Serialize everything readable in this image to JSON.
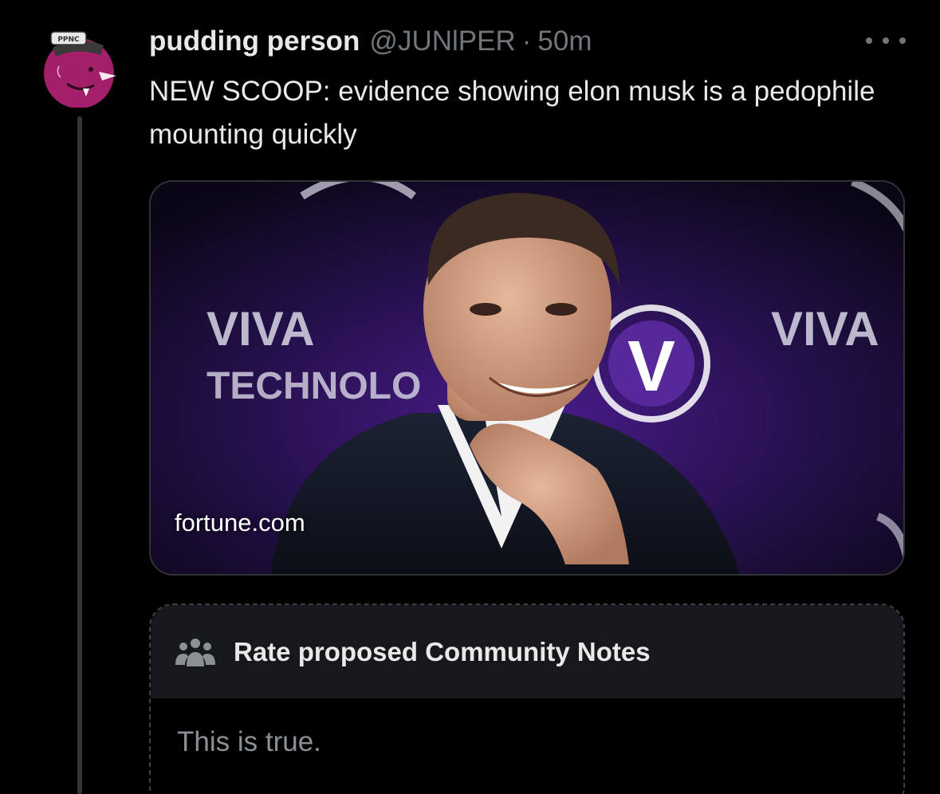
{
  "post": {
    "display_name": "pudding person",
    "handle": "@JUNlPER",
    "separator": "·",
    "time": "50m",
    "text": "NEW SCOOP:  evidence showing elon musk is a pedophile mounting quickly",
    "avatar_text": "PPNC"
  },
  "card": {
    "domain": "fortune.com",
    "backdrop_text_1": "VIVA",
    "backdrop_text_2": "TECHNOLO",
    "backdrop_badge": "V"
  },
  "community_notes": {
    "title": "Rate proposed Community Notes",
    "note": "This is true."
  },
  "colors": {
    "background": "#000000",
    "primary_text": "#e7e9ea",
    "secondary_text": "#71767b",
    "avatar": "#a31f6a",
    "notes_header_bg": "#16181c"
  },
  "icons": {
    "more": "more-dots-icon",
    "people": "people-icon"
  }
}
